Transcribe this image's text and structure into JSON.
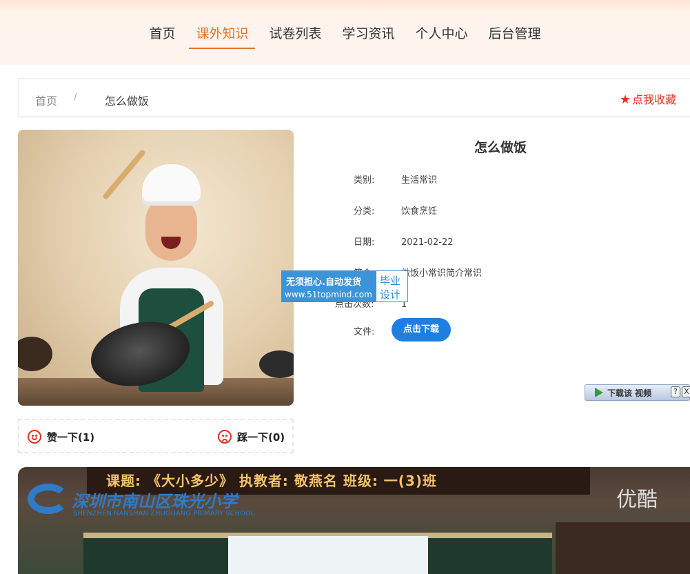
{
  "nav": {
    "items": [
      {
        "label": "首页"
      },
      {
        "label": "课外知识"
      },
      {
        "label": "试卷列表"
      },
      {
        "label": "学习资讯"
      },
      {
        "label": "个人中心"
      },
      {
        "label": "后台管理"
      }
    ],
    "active_index": 1
  },
  "breadcrumb": {
    "home": "首页",
    "separator": "/",
    "current": "怎么做饭",
    "favorite_icon": "star-icon",
    "favorite_label": "点我收藏"
  },
  "detail": {
    "title": "怎么做饭",
    "rows": [
      {
        "label": "类别:",
        "value": "生活常识"
      },
      {
        "label": "分类:",
        "value": "饮食烹饪"
      },
      {
        "label": "日期:",
        "value": "2021-02-22"
      },
      {
        "label": "简介:",
        "value": "做饭小常识简介常识"
      },
      {
        "label": "点击次数:",
        "value": "1"
      }
    ],
    "file_label": "文件:",
    "download_label": "点击下载"
  },
  "watermark": {
    "line1": "无须担心.自动发货",
    "line2": "www.51topmind.com",
    "right1": "毕业",
    "right2": "设计"
  },
  "video_toolbar": {
    "label": "下载该 视频",
    "help": "?",
    "close": "X"
  },
  "votes": {
    "like_label": "赞一下(1)",
    "dislike_label": "踩一下(0)"
  },
  "video": {
    "banner": "课题: 《大小多少》 执教者: 敬燕名 班级: 一(3)班",
    "school": "深圳市南山区珠光小学",
    "school_en": "SHENZHEN NANSHAN ZHUGUANG PRIMARY SCHOOL",
    "brand": "优酷"
  },
  "colors": {
    "accent": "#e0742a",
    "favorite": "#e0301e",
    "button": "#1e7fe0"
  }
}
